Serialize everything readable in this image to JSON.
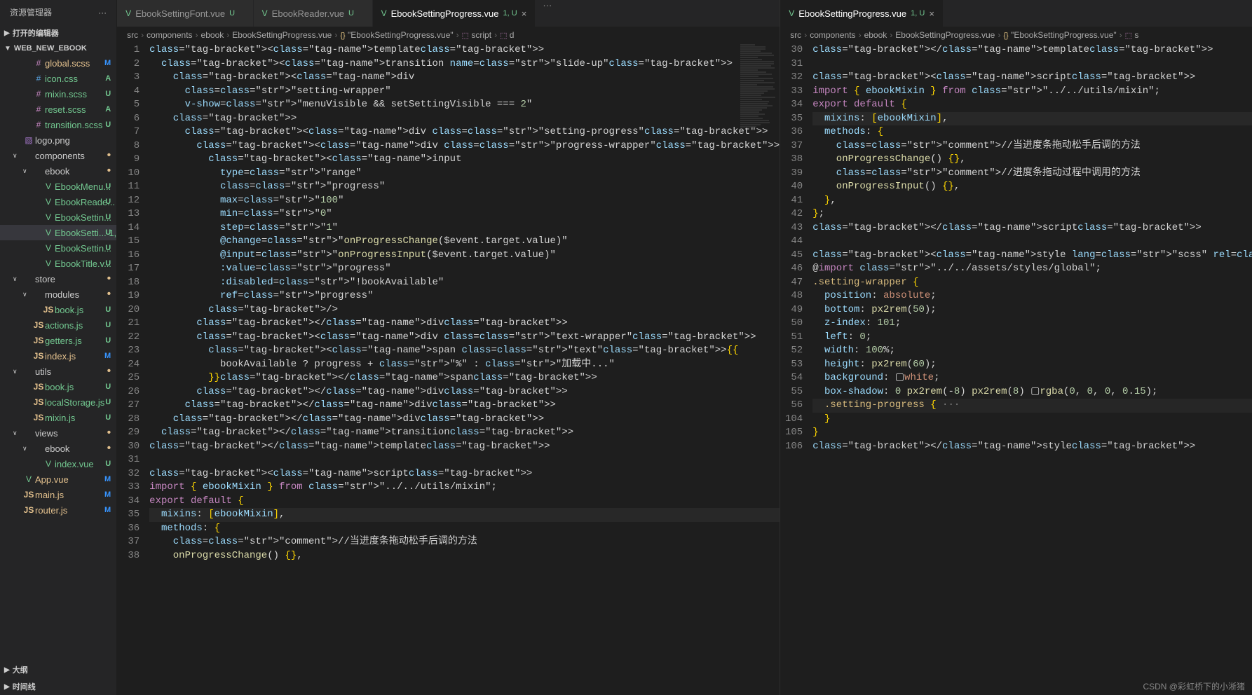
{
  "sidebar": {
    "title": "资源管理器",
    "section_open": "打开的编辑器",
    "section_project": "WEB_NEW_EBOOK",
    "section_outline": "大纲",
    "section_timeline": "时间线",
    "files": [
      {
        "indent": 2,
        "icon": "scss",
        "name": "global.scss",
        "badge": "M",
        "git": "M"
      },
      {
        "indent": 2,
        "icon": "css",
        "name": "icon.css",
        "badge": "A",
        "git": "A"
      },
      {
        "indent": 2,
        "icon": "scss",
        "name": "mixin.scss",
        "badge": "U",
        "git": "U"
      },
      {
        "indent": 2,
        "icon": "scss",
        "name": "reset.scss",
        "badge": "A",
        "git": "A"
      },
      {
        "indent": 2,
        "icon": "scss",
        "name": "transition.scss",
        "badge": "U",
        "git": "U"
      },
      {
        "indent": 1,
        "icon": "img",
        "name": "logo.png"
      },
      {
        "indent": 1,
        "icon": "folder",
        "name": "components",
        "chev": "∨",
        "dot": true
      },
      {
        "indent": 2,
        "icon": "folder",
        "name": "ebook",
        "chev": "∨",
        "dot": true
      },
      {
        "indent": 3,
        "icon": "vue",
        "name": "EbookMenu...",
        "badge": "U",
        "git": "U"
      },
      {
        "indent": 3,
        "icon": "vue",
        "name": "EbookReade...",
        "badge": "U",
        "git": "U"
      },
      {
        "indent": 3,
        "icon": "vue",
        "name": "EbookSettin...",
        "badge": "U",
        "git": "U"
      },
      {
        "indent": 3,
        "icon": "vue",
        "name": "EbookSetti... 1,",
        "badge": "U",
        "git": "U",
        "selected": true
      },
      {
        "indent": 3,
        "icon": "vue",
        "name": "EbookSettin...",
        "badge": "U",
        "git": "U"
      },
      {
        "indent": 3,
        "icon": "vue",
        "name": "EbookTitle.v...",
        "badge": "U",
        "git": "U"
      },
      {
        "indent": 1,
        "icon": "folder",
        "name": "store",
        "chev": "∨",
        "dot": true
      },
      {
        "indent": 2,
        "icon": "folder",
        "name": "modules",
        "chev": "∨",
        "dot": true
      },
      {
        "indent": 3,
        "icon": "js",
        "name": "book.js",
        "badge": "U",
        "git": "U"
      },
      {
        "indent": 2,
        "icon": "js",
        "name": "actions.js",
        "badge": "U",
        "git": "U"
      },
      {
        "indent": 2,
        "icon": "js",
        "name": "getters.js",
        "badge": "U",
        "git": "U"
      },
      {
        "indent": 2,
        "icon": "js",
        "name": "index.js",
        "badge": "M",
        "git": "M"
      },
      {
        "indent": 1,
        "icon": "folder",
        "name": "utils",
        "chev": "∨",
        "dot": true
      },
      {
        "indent": 2,
        "icon": "js",
        "name": "book.js",
        "badge": "U",
        "git": "U"
      },
      {
        "indent": 2,
        "icon": "js",
        "name": "localStorage.js",
        "badge": "U",
        "git": "U"
      },
      {
        "indent": 2,
        "icon": "js",
        "name": "mixin.js",
        "badge": "U",
        "git": "U"
      },
      {
        "indent": 1,
        "icon": "folder",
        "name": "views",
        "chev": "∨",
        "dot": true
      },
      {
        "indent": 2,
        "icon": "folder",
        "name": "ebook",
        "chev": "∨",
        "dot": true
      },
      {
        "indent": 3,
        "icon": "vue",
        "name": "index.vue",
        "badge": "U",
        "git": "U"
      },
      {
        "indent": 1,
        "icon": "vue",
        "name": "App.vue",
        "badge": "M",
        "git": "M"
      },
      {
        "indent": 1,
        "icon": "js",
        "name": "main.js",
        "badge": "M",
        "git": "M"
      },
      {
        "indent": 1,
        "icon": "js",
        "name": "router.js",
        "badge": "M",
        "git": "M"
      }
    ]
  },
  "tabs_left": [
    {
      "label": "EbookSettingFont.vue",
      "mod": "U",
      "active": false
    },
    {
      "label": "EbookReader.vue",
      "mod": "U",
      "active": false
    },
    {
      "label": "EbookSettingProgress.vue",
      "mod": "1, U",
      "active": true
    }
  ],
  "tabs_right": [
    {
      "label": "EbookSettingProgress.vue",
      "mod": "1, U",
      "active": true
    }
  ],
  "breadcrumb_left": [
    "src",
    "components",
    "ebook",
    "EbookSettingProgress.vue",
    "{} \"EbookSettingProgress.vue\"",
    "script",
    "d"
  ],
  "breadcrumb_right": [
    "src",
    "components",
    "ebook",
    "EbookSettingProgress.vue",
    "{} \"EbookSettingProgress.vue\"",
    "s"
  ],
  "code_left": {
    "start": 1,
    "lines": [
      "<template>",
      "  <transition name=\"slide-up\">",
      "    <div",
      "      class=\"setting-wrapper\"",
      "      v-show=\"menuVisible && setSettingVisible === 2\"",
      "    >",
      "      <div class=\"setting-progress\">",
      "        <div class=\"progress-wrapper\">",
      "          <input",
      "            type=\"range\"",
      "            class=\"progress\"",
      "            max=\"100\"",
      "            min=\"0\"",
      "            step=\"1\"",
      "            @change=\"onProgressChange($event.target.value)\"",
      "            @input=\"onProgressInput($event.target.value)\"",
      "            :value=\"progress\"",
      "            :disabled=\"!bookAvailable\"",
      "            ref=\"progress\"",
      "          />",
      "        </div>",
      "        <div class=\"text-wrapper\">",
      "          <span class=\"text\">{{",
      "            bookAvailable ? progress + \"%\" : \"加载中...\"",
      "          }}</span>",
      "        </div>",
      "      </div>",
      "    </div>",
      "  </transition>",
      "</template>",
      "",
      "<script>",
      "import { ebookMixin } from \"../../utils/mixin\";",
      "export default {",
      "  mixins: [ebookMixin],",
      "  methods: {",
      "    //当进度条拖动松手后调的方法",
      "    onProgressChange() {},"
    ]
  },
  "code_right": {
    "start": 30,
    "lines": [
      "</template>",
      "",
      "<script>",
      "import { ebookMixin } from \"../../utils/mixin\";",
      "export default {",
      "  mixins: [ebookMixin],",
      "  methods: {",
      "    //当进度条拖动松手后调的方法",
      "    onProgressChange() {},",
      "    //进度条拖动过程中调用的方法",
      "    onProgressInput() {},",
      "  },",
      "};",
      "</script>",
      "",
      "<style lang=\"scss\" rel=\"stylesheet/scss\" scoped>",
      "@import \"../../assets/styles/global\";",
      ".setting-wrapper {",
      "  position: absolute;",
      "  bottom: px2rem(50);",
      "  z-index: 101;",
      "  left: 0;",
      "  width: 100%;",
      "  height: px2rem(60);",
      "  background: ▢white;",
      "  box-shadow: 0 px2rem(-8) px2rem(8) ▢rgba(0, 0, 0, 0.15);",
      "  .setting-progress { ···",
      "  }",
      "}",
      "</style>"
    ],
    "line_numbers": [
      30,
      31,
      32,
      33,
      34,
      35,
      36,
      37,
      38,
      39,
      40,
      41,
      42,
      43,
      44,
      45,
      46,
      47,
      48,
      49,
      50,
      51,
      52,
      53,
      54,
      55,
      56,
      104,
      105,
      106
    ]
  },
  "watermark": "CSDN @彩虹桥下的小淅猪"
}
